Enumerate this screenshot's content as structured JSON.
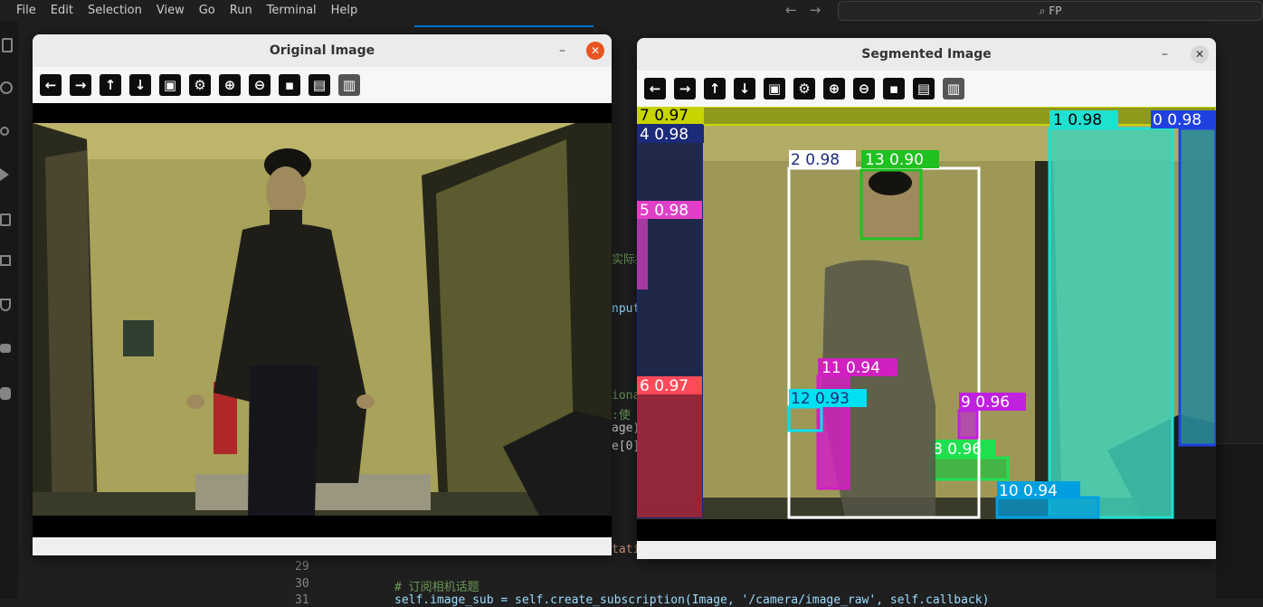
{
  "menu": [
    "File",
    "Edit",
    "Selection",
    "View",
    "Go",
    "Run",
    "Terminal",
    "Help"
  ],
  "nav": {
    "back": "←",
    "forward": "→"
  },
  "search": {
    "icon": "⌕",
    "text": "FP"
  },
  "code": {
    "snippets": [
      "实际挂",
      "nput",
      "iona",
      ":使",
      "age)",
      "e[0]",
      "tati"
    ],
    "line_numbers": [
      "29",
      "30",
      "31"
    ],
    "comment": "# 订阅相机话题",
    "partial_line": "self.image_sub = self.create_subscription(Image, '/camera/image_raw', self.callback)"
  },
  "original_window": {
    "title": "Original Image",
    "minimize": "–",
    "close": "✕",
    "toolbar": [
      {
        "icon": "arrow-left-icon",
        "glyph": "←"
      },
      {
        "icon": "arrow-right-icon",
        "glyph": "→"
      },
      {
        "icon": "arrow-up-icon",
        "glyph": "↑"
      },
      {
        "icon": "arrow-down-icon",
        "glyph": "↓"
      },
      {
        "icon": "image-icon",
        "glyph": "▣"
      },
      {
        "icon": "image-settings-icon",
        "glyph": "⚙"
      },
      {
        "icon": "zoom-in-icon",
        "glyph": "⊕"
      },
      {
        "icon": "zoom-out-icon",
        "glyph": "⊖"
      },
      {
        "icon": "save-icon",
        "glyph": "▪"
      },
      {
        "icon": "clipboard-icon",
        "glyph": "▤"
      },
      {
        "icon": "properties-icon",
        "glyph": "▥"
      }
    ]
  },
  "segmented_window": {
    "title": "Segmented Image",
    "minimize": "–",
    "close": "✕",
    "toolbar": [
      {
        "icon": "arrow-left-icon",
        "glyph": "←"
      },
      {
        "icon": "arrow-right-icon",
        "glyph": "→"
      },
      {
        "icon": "arrow-up-icon",
        "glyph": "↑"
      },
      {
        "icon": "arrow-down-icon",
        "glyph": "↓"
      },
      {
        "icon": "image-icon",
        "glyph": "▣"
      },
      {
        "icon": "image-settings-icon",
        "glyph": "⚙"
      },
      {
        "icon": "zoom-in-icon",
        "glyph": "⊕"
      },
      {
        "icon": "zoom-out-icon",
        "glyph": "⊖"
      },
      {
        "icon": "save-icon",
        "glyph": "▪"
      },
      {
        "icon": "clipboard-icon",
        "glyph": "▤"
      },
      {
        "icon": "properties-icon",
        "glyph": "▥"
      }
    ],
    "detections": [
      {
        "label": "7 0.97",
        "color": "#c8d400"
      },
      {
        "label": "4 0.98",
        "color": "#1c2a7a"
      },
      {
        "label": "5 0.98",
        "color": "#e040c8"
      },
      {
        "label": "6 0.97",
        "color": "#ff4a5a"
      },
      {
        "label": "2 0.98",
        "color": "#ffffff"
      },
      {
        "label": "13 0.90",
        "color": "#20c020"
      },
      {
        "label": "11 0.94",
        "color": "#d020c0"
      },
      {
        "label": "12 0.93",
        "color": "#00e0f0"
      },
      {
        "label": "9 0.96",
        "color": "#c020e0"
      },
      {
        "label": "8 0.96",
        "color": "#20e050"
      },
      {
        "label": "10 0.94",
        "color": "#00a0e0"
      },
      {
        "label": "1 0.98",
        "color": "#20e0d0"
      },
      {
        "label": "0 0.98",
        "color": "#2040e0"
      }
    ]
  }
}
